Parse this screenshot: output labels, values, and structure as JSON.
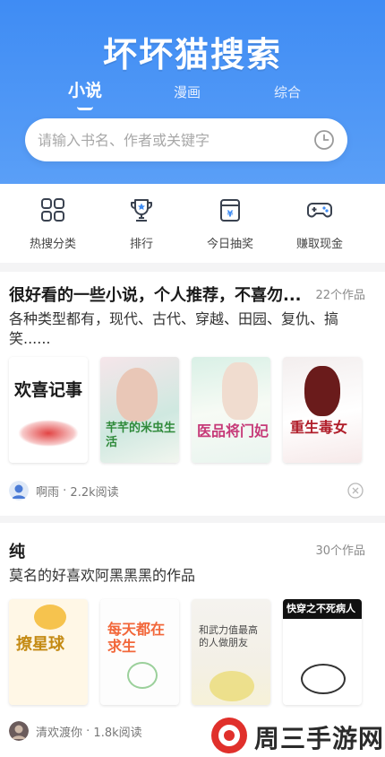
{
  "header": {
    "logo": "坏坏猫搜索"
  },
  "tabs": [
    {
      "label": "小说",
      "active": true
    },
    {
      "label": "漫画",
      "active": false
    },
    {
      "label": "综合",
      "active": false
    }
  ],
  "search": {
    "placeholder": "请输入书名、作者或关键字",
    "icon": "history-clock-icon"
  },
  "quick_actions": [
    {
      "label": "热搜分类",
      "icon": "grid-icon"
    },
    {
      "label": "排行",
      "icon": "trophy-icon"
    },
    {
      "label": "今日抽奖",
      "icon": "lottery-icon"
    },
    {
      "label": "赚取现金",
      "icon": "gamepad-icon"
    }
  ],
  "lists": [
    {
      "title": "很好看的一些小说，个人推荐，不喜勿...",
      "count": "22个作品",
      "desc": "各种类型都有，现代、古代、穿越、田园、复仇、搞笑......",
      "covers": [
        "欢喜记事",
        "芊芊的米虫生活",
        "医品将门妃",
        "重生毒女"
      ],
      "author": "啊雨",
      "reads": "2.2k阅读"
    },
    {
      "title": "纯",
      "count": "30个作品",
      "desc": "莫名的好喜欢阿黑黑黑的作品",
      "covers": [
        "撩星球",
        "每天都在求生",
        "和武力值最高的人做朋友",
        "快穿之不死病人"
      ],
      "author": "清欢渡你",
      "reads": "1.8k阅读"
    }
  ],
  "watermark": {
    "text": "周三手游网"
  },
  "colors": {
    "brand": "#3f8cf4",
    "background": "#ffffff",
    "separator": "#f4f4f5"
  }
}
